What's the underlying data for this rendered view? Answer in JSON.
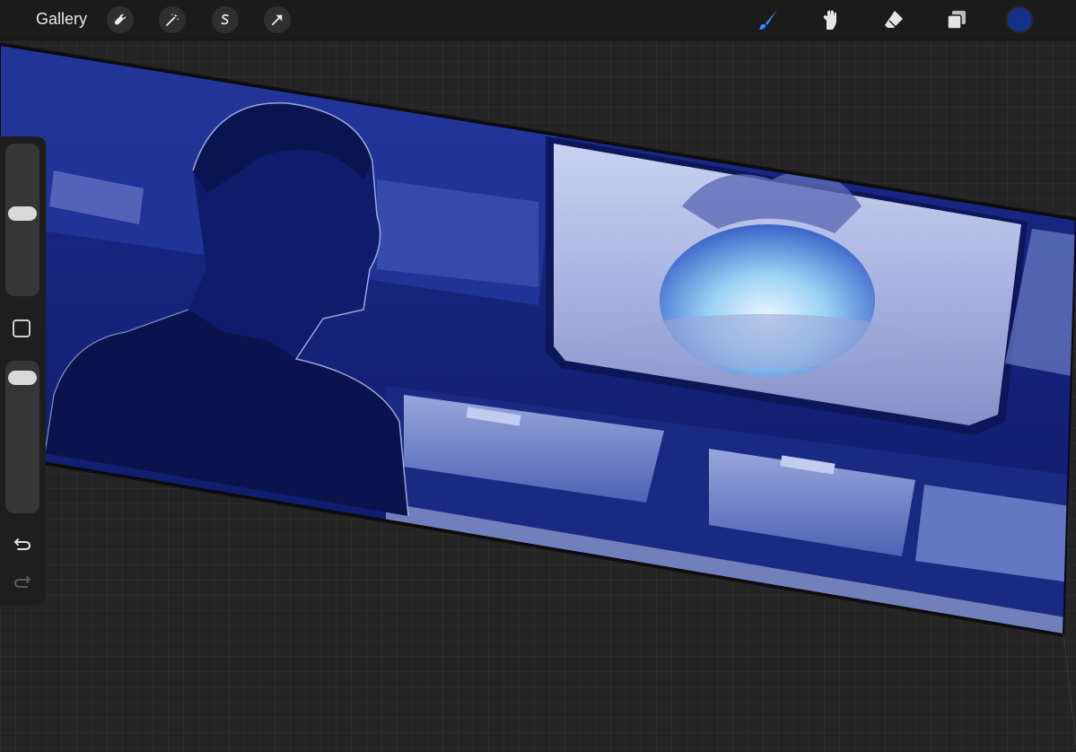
{
  "toolbar": {
    "gallery_label": "Gallery",
    "left_tools": [
      {
        "name": "wrench-icon"
      },
      {
        "name": "magic-wand-icon"
      },
      {
        "name": "selection-s-icon"
      },
      {
        "name": "transform-arrow-icon"
      }
    ],
    "right_tools": [
      {
        "name": "brush-icon",
        "active": true
      },
      {
        "name": "smudge-icon"
      },
      {
        "name": "eraser-icon"
      },
      {
        "name": "layers-icon"
      }
    ],
    "current_color": "#14318c",
    "accent_color": "#2f8dff"
  },
  "sidebar": {
    "brush_size_level": 0.55,
    "opacity_level": 0.95,
    "buttons": [
      "modify-square",
      "undo-icon",
      "redo-icon"
    ]
  }
}
